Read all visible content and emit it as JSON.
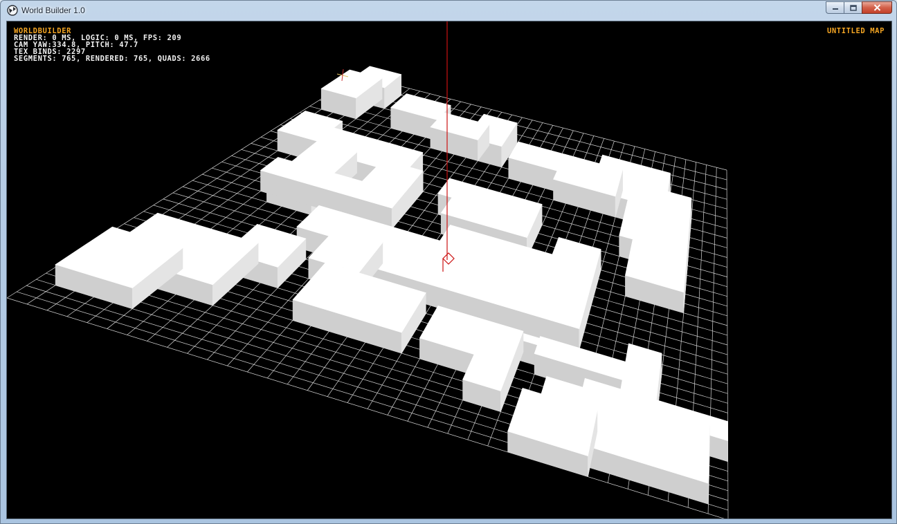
{
  "window": {
    "title": "World Builder 1.0"
  },
  "hud": {
    "app_name": "WORLDBUILDER",
    "render_stats": "RENDER: 0 MS, LOGIC: 0 MS, FPS: 209",
    "camera_stats": "CAM YAW:334.8, PITCH: 47.7",
    "tex_binds": "TEX BINDS: 2297",
    "segments": "SEGMENTS: 765, RENDERED: 765, QUADS: 2666",
    "map_name": "UNTITLED MAP"
  },
  "colors": {
    "hud_accent": "#f5a623",
    "hud_text": "#f2f2f2",
    "background": "#000000",
    "grid": "#d8d8d8",
    "block_top": "#ffffff",
    "block_side": "#dcdcdc",
    "axis": "#cc1010"
  }
}
